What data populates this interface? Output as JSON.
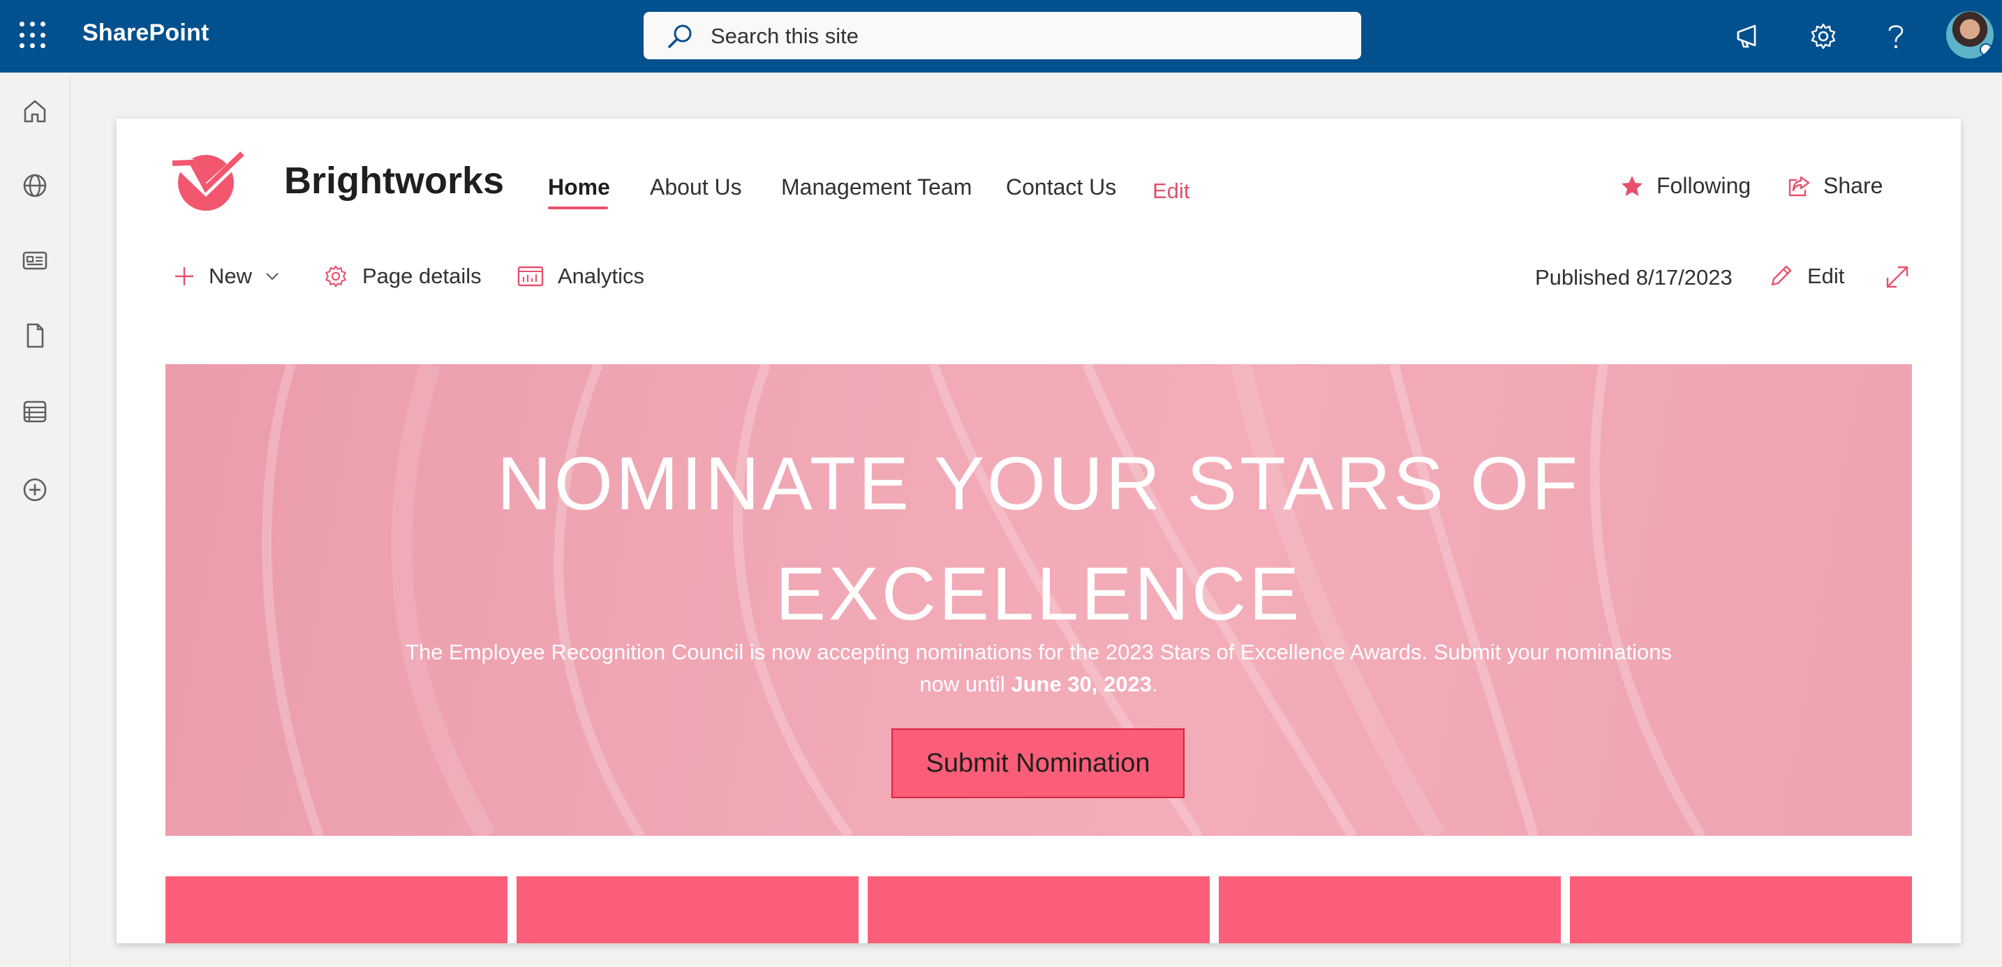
{
  "suite": {
    "app_name": "SharePoint",
    "search_placeholder": "Search this site"
  },
  "site": {
    "title": "Brightworks",
    "nav": [
      {
        "label": "Home",
        "active": true
      },
      {
        "label": "About Us"
      },
      {
        "label": "Management Team"
      },
      {
        "label": "Contact Us"
      }
    ],
    "nav_edit": "Edit",
    "following_label": "Following",
    "share_label": "Share"
  },
  "commandbar": {
    "new_label": "New",
    "page_details_label": "Page details",
    "analytics_label": "Analytics",
    "published": "Published 8/17/2023",
    "edit_label": "Edit"
  },
  "hero": {
    "title_line1": "NOMINATE YOUR STARS OF",
    "title_line2": "EXCELLENCE",
    "body_text": "The Employee Recognition Council is now accepting nominations for the 2023 Stars of Excellence Awards. Submit your nominations now until",
    "body_date": "June 30, 2023",
    "body_end": ".",
    "button_label": "Submit Nomination"
  },
  "colors": {
    "suite_bar": "#03508e",
    "accent": "#e8516d",
    "button": "#fb5e78",
    "hero": "#f1a9b6"
  },
  "tiles_count": 5
}
